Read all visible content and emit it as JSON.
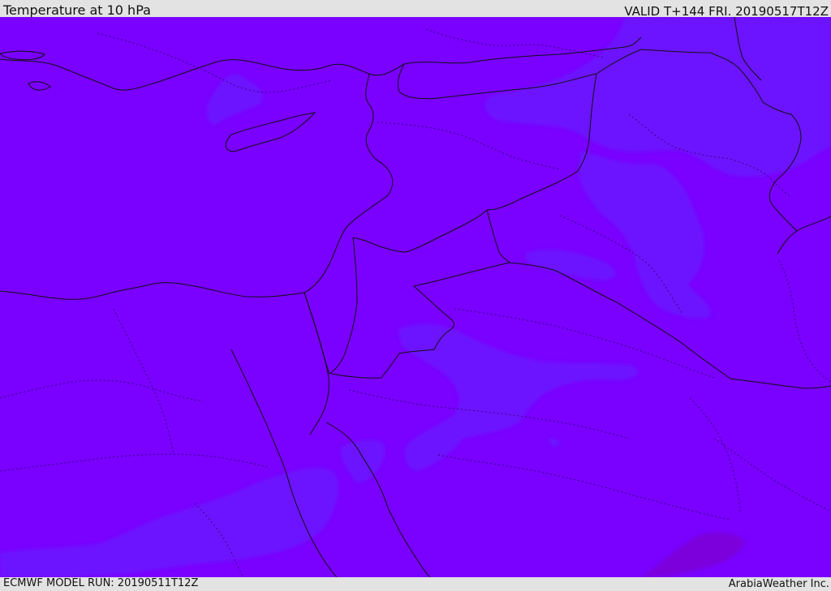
{
  "header": {
    "title": "Temperature at 10 hPa",
    "valid": "VALID T+144 FRI. 20190517T12Z"
  },
  "footer": {
    "model_run": "ECMWF MODEL RUN: 20190511T12Z",
    "brand": "ArabiaWeather Inc."
  },
  "map": {
    "colors": {
      "base_fill": "#7a00ff",
      "cooler_patch": "#6c18ff",
      "warm_patch": "#7b00da",
      "border_line": "#111111",
      "admin_dash": "#39007a"
    },
    "layers": {
      "coastlines": true,
      "country_borders": true,
      "admin_borders_dotted": true,
      "temperature_fill": true
    }
  }
}
